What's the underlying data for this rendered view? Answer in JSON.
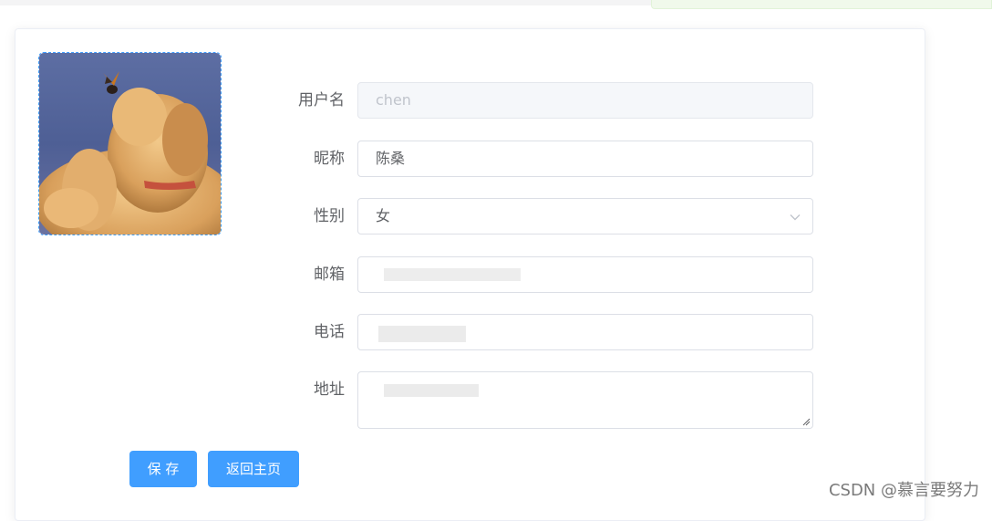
{
  "form": {
    "username_label": "用户名",
    "username_value": "chen",
    "nickname_label": "昵称",
    "nickname_value": "陈桑",
    "gender_label": "性别",
    "gender_value": "女",
    "email_label": "邮箱",
    "phone_label": "电话",
    "address_label": "地址"
  },
  "buttons": {
    "save_label": "保 存",
    "back_label": "返回主页"
  },
  "watermark": "CSDN @慕言要努力",
  "colors": {
    "primary": "#409eff",
    "label_text": "#606266",
    "disabled_bg": "#f5f7fa",
    "border": "#dcdfe6"
  },
  "icons": {
    "select_arrow": "chevron-down-icon",
    "textarea_resize": "resize-handle-icon"
  }
}
